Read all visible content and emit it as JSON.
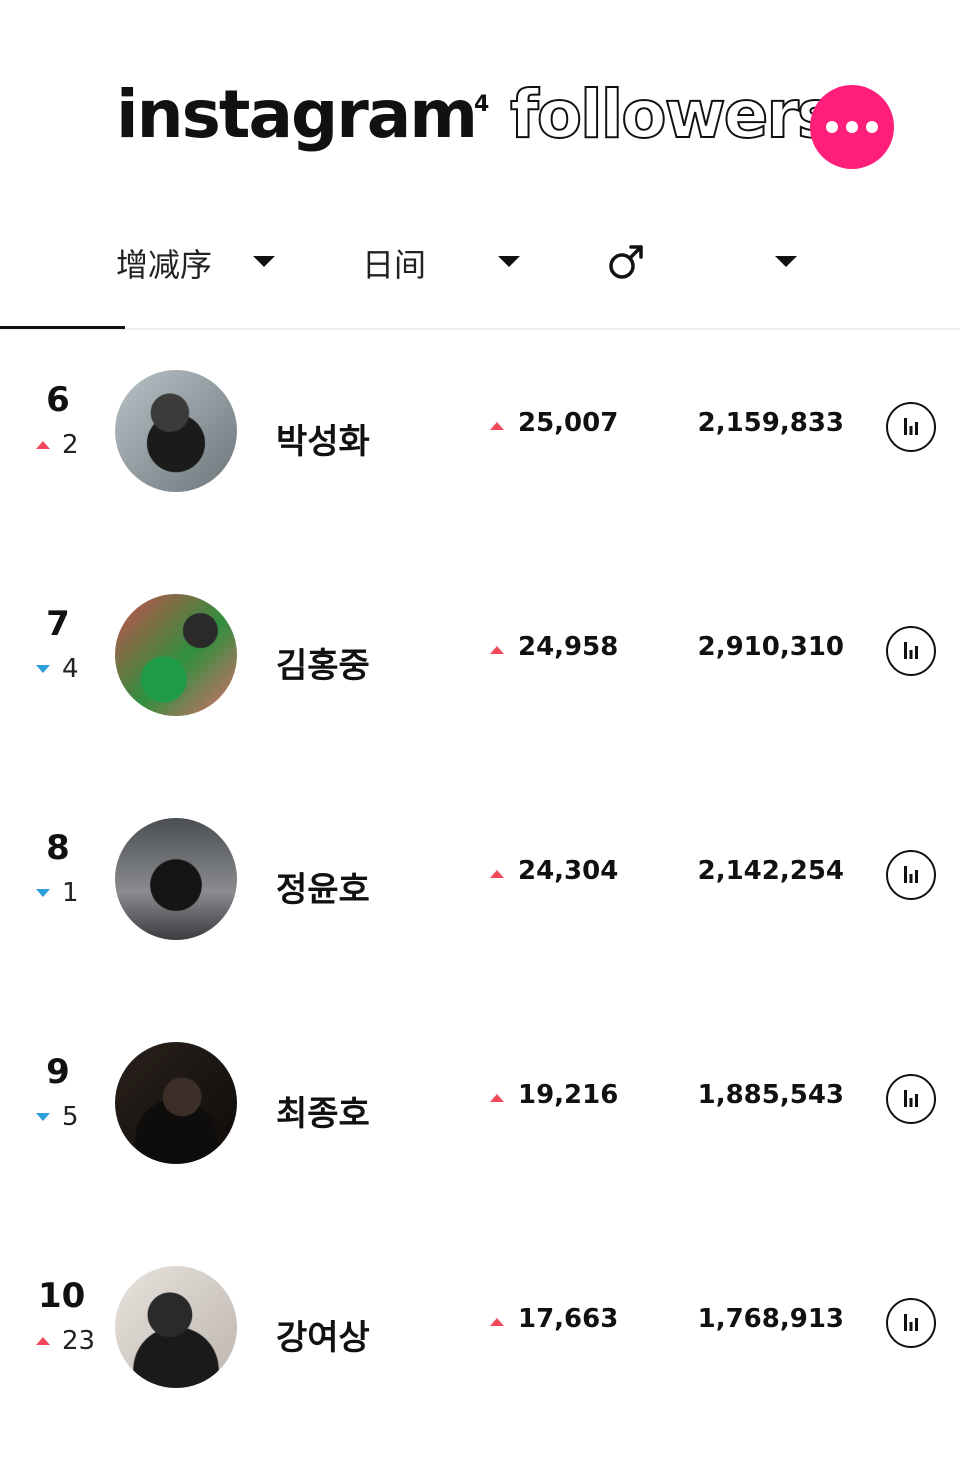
{
  "header": {
    "brand": "instagram",
    "superscript": "4",
    "title_outline": "followers",
    "more_icon": "more-dots-icon",
    "accent_color": "#ff1f7a"
  },
  "filters": {
    "sort_label": "增减序",
    "period_label": "日间",
    "gender_icon": "male-symbol-icon",
    "caret_icon": "caret-down-icon"
  },
  "colors": {
    "up": "#ef4a5b",
    "down": "#2a9fd8"
  },
  "rows": [
    {
      "rank": "6",
      "change_dir": "up",
      "change": "2",
      "name": "박성화",
      "daily": "25,007",
      "total": "2,159,833"
    },
    {
      "rank": "7",
      "change_dir": "down",
      "change": "4",
      "name": "김홍중",
      "daily": "24,958",
      "total": "2,910,310"
    },
    {
      "rank": "8",
      "change_dir": "down",
      "change": "1",
      "name": "정윤호",
      "daily": "24,304",
      "total": "2,142,254"
    },
    {
      "rank": "9",
      "change_dir": "down",
      "change": "5",
      "name": "최종호",
      "daily": "19,216",
      "total": "1,885,543"
    },
    {
      "rank": "10",
      "change_dir": "up",
      "change": "23",
      "name": "강여상",
      "daily": "17,663",
      "total": "1,768,913"
    }
  ]
}
